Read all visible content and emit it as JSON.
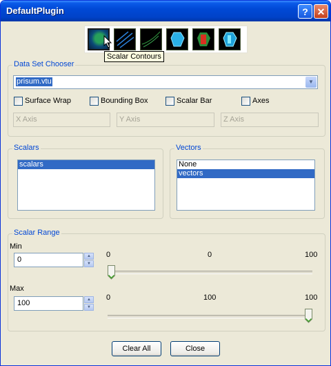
{
  "window": {
    "title": "DefaultPlugin",
    "help_glyph": "?",
    "close_glyph": "✕"
  },
  "toolbar": {
    "tools": [
      {
        "name": "scalar-contours-icon",
        "active": true
      },
      {
        "name": "streamlines-icon"
      },
      {
        "name": "glyphs-icon"
      },
      {
        "name": "surface-icon"
      },
      {
        "name": "color-map-icon"
      },
      {
        "name": "volume-icon"
      }
    ],
    "tooltip": "Scalar Contours"
  },
  "dataset": {
    "group_label": "Data Set Chooser",
    "selected_file": "prisum.vtu",
    "checkboxes": [
      {
        "label": "Surface Wrap",
        "checked": false
      },
      {
        "label": "Bounding Box",
        "checked": false
      },
      {
        "label": "Scalar Bar",
        "checked": false
      },
      {
        "label": "Axes",
        "checked": false
      }
    ],
    "axis_fields": [
      "X Axis",
      "Y Axis",
      "Z Axis"
    ]
  },
  "scalars": {
    "group_label": "Scalars",
    "items": [
      "scalars"
    ],
    "selected_index": 0
  },
  "vectors": {
    "group_label": "Vectors",
    "items": [
      "None",
      "vectors"
    ],
    "selected_index": 1
  },
  "scalar_range": {
    "group_label": "Scalar Range",
    "min": {
      "label": "Min",
      "value": "0",
      "ticks": [
        "0",
        "0",
        "100"
      ],
      "slider_value": 0,
      "slider_max": 100
    },
    "max": {
      "label": "Max",
      "value": "100",
      "ticks": [
        "0",
        "100",
        "100"
      ],
      "slider_value": 100,
      "slider_max": 100
    }
  },
  "buttons": {
    "clear_all": "Clear All",
    "close": "Close"
  }
}
